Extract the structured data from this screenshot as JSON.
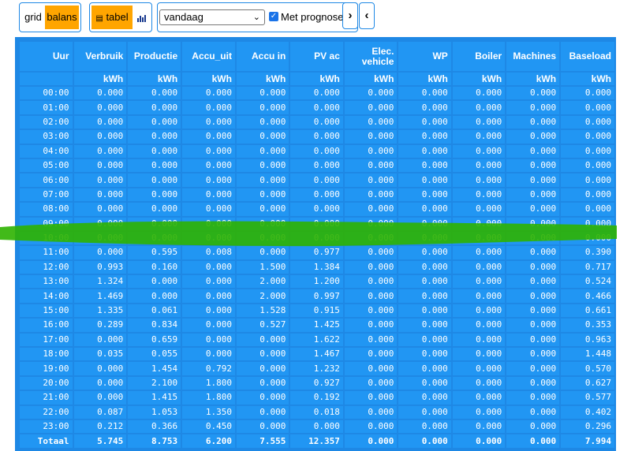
{
  "toolbar": {
    "view_buttons": [
      "grid",
      "balans"
    ],
    "tabel_label": "tabel",
    "tabel_icon": "table-icon",
    "chart_icon": "bar-chart-icon",
    "period_select": "vandaag",
    "prognose_label": "Met prognose",
    "prognose_checked": true,
    "next_icon": "chevron-right-icon",
    "prev_icon": "chevron-left-icon",
    "accent_color": "#ffa500"
  },
  "table": {
    "headers": [
      "Uur",
      "Verbruik",
      "Productie",
      "Accu_uit",
      "Accu in",
      "PV ac",
      "Elec. vehicle",
      "WP",
      "Boiler",
      "Machines",
      "Baseload"
    ],
    "units": [
      "",
      "kWh",
      "kWh",
      "kWh",
      "kWh",
      "kWh",
      "kWh",
      "kWh",
      "kWh",
      "kWh",
      "kWh"
    ],
    "rows": [
      [
        "00:00",
        "0.000",
        "0.000",
        "0.000",
        "0.000",
        "0.000",
        "0.000",
        "0.000",
        "0.000",
        "0.000",
        "0.000"
      ],
      [
        "01:00",
        "0.000",
        "0.000",
        "0.000",
        "0.000",
        "0.000",
        "0.000",
        "0.000",
        "0.000",
        "0.000",
        "0.000"
      ],
      [
        "02:00",
        "0.000",
        "0.000",
        "0.000",
        "0.000",
        "0.000",
        "0.000",
        "0.000",
        "0.000",
        "0.000",
        "0.000"
      ],
      [
        "03:00",
        "0.000",
        "0.000",
        "0.000",
        "0.000",
        "0.000",
        "0.000",
        "0.000",
        "0.000",
        "0.000",
        "0.000"
      ],
      [
        "04:00",
        "0.000",
        "0.000",
        "0.000",
        "0.000",
        "0.000",
        "0.000",
        "0.000",
        "0.000",
        "0.000",
        "0.000"
      ],
      [
        "05:00",
        "0.000",
        "0.000",
        "0.000",
        "0.000",
        "0.000",
        "0.000",
        "0.000",
        "0.000",
        "0.000",
        "0.000"
      ],
      [
        "06:00",
        "0.000",
        "0.000",
        "0.000",
        "0.000",
        "0.000",
        "0.000",
        "0.000",
        "0.000",
        "0.000",
        "0.000"
      ],
      [
        "07:00",
        "0.000",
        "0.000",
        "0.000",
        "0.000",
        "0.000",
        "0.000",
        "0.000",
        "0.000",
        "0.000",
        "0.000"
      ],
      [
        "08:00",
        "0.000",
        "0.000",
        "0.000",
        "0.000",
        "0.000",
        "0.000",
        "0.000",
        "0.000",
        "0.000",
        "0.000"
      ],
      [
        "09:00",
        "0.000",
        "0.000",
        "0.000",
        "0.000",
        "0.000",
        "0.000",
        "0.000",
        "0.000",
        "0.000",
        "0.000"
      ],
      [
        "10:00",
        "0.000",
        "0.000",
        "0.000",
        "0.000",
        "0.000",
        "0.000",
        "0.000",
        "0.000",
        "0.000",
        "0.000"
      ],
      [
        "11:00",
        "0.000",
        "0.595",
        "0.008",
        "0.000",
        "0.977",
        "0.000",
        "0.000",
        "0.000",
        "0.000",
        "0.390"
      ],
      [
        "12:00",
        "0.993",
        "0.160",
        "0.000",
        "1.500",
        "1.384",
        "0.000",
        "0.000",
        "0.000",
        "0.000",
        "0.717"
      ],
      [
        "13:00",
        "1.324",
        "0.000",
        "0.000",
        "2.000",
        "1.200",
        "0.000",
        "0.000",
        "0.000",
        "0.000",
        "0.524"
      ],
      [
        "14:00",
        "1.469",
        "0.000",
        "0.000",
        "2.000",
        "0.997",
        "0.000",
        "0.000",
        "0.000",
        "0.000",
        "0.466"
      ],
      [
        "15:00",
        "1.335",
        "0.061",
        "0.000",
        "1.528",
        "0.915",
        "0.000",
        "0.000",
        "0.000",
        "0.000",
        "0.661"
      ],
      [
        "16:00",
        "0.289",
        "0.834",
        "0.000",
        "0.527",
        "1.425",
        "0.000",
        "0.000",
        "0.000",
        "0.000",
        "0.353"
      ],
      [
        "17:00",
        "0.000",
        "0.659",
        "0.000",
        "0.000",
        "1.622",
        "0.000",
        "0.000",
        "0.000",
        "0.000",
        "0.963"
      ],
      [
        "18:00",
        "0.035",
        "0.055",
        "0.000",
        "0.000",
        "1.467",
        "0.000",
        "0.000",
        "0.000",
        "0.000",
        "1.448"
      ],
      [
        "19:00",
        "0.000",
        "1.454",
        "0.792",
        "0.000",
        "1.232",
        "0.000",
        "0.000",
        "0.000",
        "0.000",
        "0.570"
      ],
      [
        "20:00",
        "0.000",
        "2.100",
        "1.800",
        "0.000",
        "0.927",
        "0.000",
        "0.000",
        "0.000",
        "0.000",
        "0.627"
      ],
      [
        "21:00",
        "0.000",
        "1.415",
        "1.800",
        "0.000",
        "0.192",
        "0.000",
        "0.000",
        "0.000",
        "0.000",
        "0.577"
      ],
      [
        "22:00",
        "0.087",
        "1.053",
        "1.350",
        "0.000",
        "0.018",
        "0.000",
        "0.000",
        "0.000",
        "0.000",
        "0.402"
      ],
      [
        "23:00",
        "0.212",
        "0.366",
        "0.450",
        "0.000",
        "0.000",
        "0.000",
        "0.000",
        "0.000",
        "0.000",
        "0.296"
      ]
    ],
    "total": [
      "Totaal",
      "5.745",
      "8.753",
      "6.200",
      "7.555",
      "12.357",
      "0.000",
      "0.000",
      "0.000",
      "0.000",
      "7.994"
    ],
    "highlighted_row": "10:00",
    "highlight_color": "#2db200"
  }
}
